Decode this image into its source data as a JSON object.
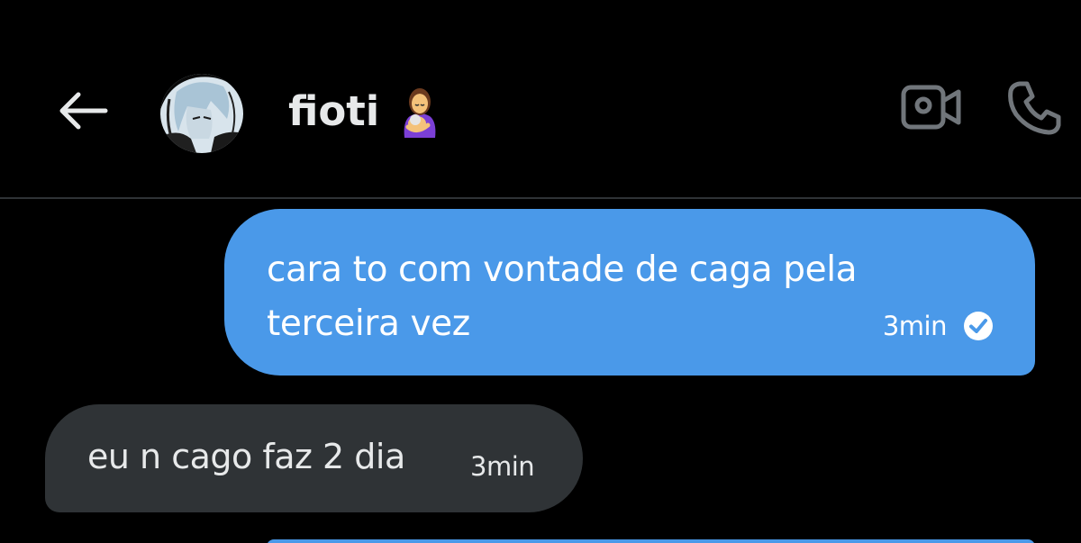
{
  "header": {
    "back_icon": "arrow-left-icon",
    "contact_name": "fioti",
    "contact_emoji_icon": "breastfeeding-woman-emoji",
    "video_icon": "video-camera-icon",
    "phone_icon": "phone-icon"
  },
  "messages": [
    {
      "direction": "outgoing",
      "lines": [
        "cara to com vontade de caga pela",
        "terceira vez"
      ],
      "time": "3min",
      "status_icon": "check-circle-icon"
    },
    {
      "direction": "incoming",
      "text": "eu n cago faz 2 dia",
      "time": "3min"
    }
  ],
  "colors": {
    "background": "#000000",
    "outgoing_bubble": "#4a99e9",
    "incoming_bubble": "#2f3336",
    "text_primary": "#e7e9ea",
    "icon_gray": "#71767b"
  }
}
